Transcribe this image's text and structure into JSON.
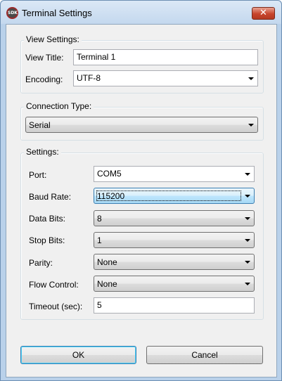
{
  "window": {
    "title": "Terminal Settings",
    "icon": "sdk-app-icon",
    "close_glyph": "✕",
    "icon_text": "SDK"
  },
  "view_settings": {
    "group_title": "View Settings:",
    "view_title_label": "View Title:",
    "view_title_value": "Terminal 1",
    "encoding_label": "Encoding:",
    "encoding_value": "UTF-8"
  },
  "connection": {
    "group_title": "Connection Type:",
    "value": "Serial"
  },
  "settings": {
    "group_title": "Settings:",
    "port_label": "Port:",
    "port_value": "COM5",
    "baud_label": "Baud Rate:",
    "baud_value": "115200",
    "data_bits_label": "Data Bits:",
    "data_bits_value": "8",
    "stop_bits_label": "Stop Bits:",
    "stop_bits_value": "1",
    "parity_label": "Parity:",
    "parity_value": "None",
    "flow_label": "Flow Control:",
    "flow_value": "None",
    "timeout_label": "Timeout (sec):",
    "timeout_value": "5"
  },
  "buttons": {
    "ok": "OK",
    "cancel": "Cancel"
  },
  "colors": {
    "titlebar": "#c4d8ee",
    "close_button": "#c7452c",
    "dialog_background": "#f0f0f0",
    "focus_border": "#3c7fb1"
  }
}
